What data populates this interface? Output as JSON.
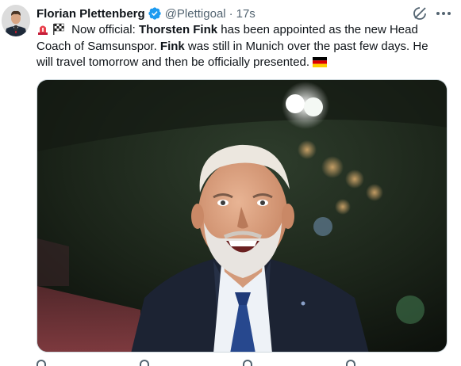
{
  "author": {
    "display_name": "Florian Plettenberg",
    "handle": "@Plettigoal",
    "separator": "·",
    "timestamp": "17s"
  },
  "tweet": {
    "seg1": " Now official: ",
    "name1": "Thorsten Fink",
    "seg2": " has been appointed as the new Head Coach of Samsunspor. ",
    "name2": "Fink",
    "seg3": " was still in Munich over the past few days. He will travel tomorrow and then be officially presented. "
  },
  "icons": [
    "siren-emoji",
    "checkered-flag-emoji",
    "germany-flag-emoji",
    "verified-badge-icon",
    "grok-icon",
    "more-icon"
  ],
  "colors": {
    "verified_blue": "#1d9bf0",
    "secondary_text": "#536471",
    "primary_text": "#0f1419"
  }
}
